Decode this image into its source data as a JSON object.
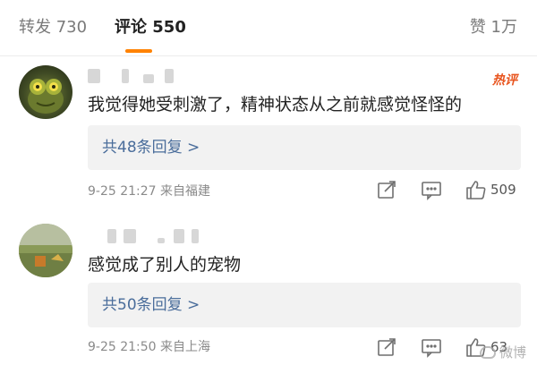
{
  "tabs": {
    "repost": "转发 730",
    "comment": "评论 550",
    "like": "赞 1万"
  },
  "comments": [
    {
      "hot_badge": "热评",
      "text": "我觉得她受刺激了，精神状态从之前就感觉怪怪的",
      "reply_link": "共48条回复 >",
      "meta": "9-25 21:27  来自福建",
      "like_count": "509",
      "avatar_icon": "frog-avatar-icon"
    },
    {
      "text": "感觉成了别人的宠物",
      "reply_link": "共50条回复 >",
      "meta": "9-25 21:50  来自上海",
      "like_count": "63",
      "avatar_icon": "landscape-avatar-icon"
    }
  ],
  "watermark": "微博",
  "colors": {
    "accent_underline": "#ff8200",
    "hot_badge": "#e8541e",
    "reply_link": "#4a6d9b",
    "reply_box_bg": "#f2f2f2"
  }
}
